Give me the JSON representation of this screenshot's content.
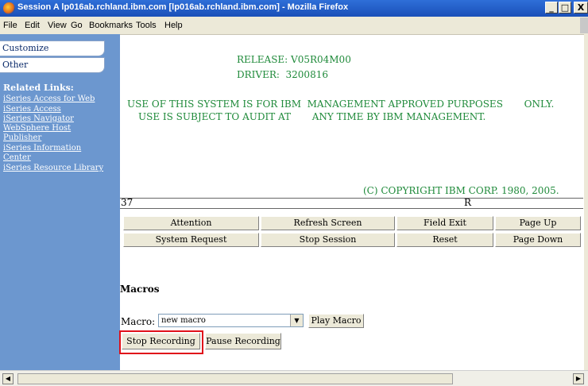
{
  "window": {
    "title": "Session A lp016ab.rchland.ibm.com [lp016ab.rchland.ibm.com] - Mozilla Firefox",
    "minimize": "_",
    "maximize": "□",
    "close": "X"
  },
  "menu": {
    "items": [
      {
        "label": "File"
      },
      {
        "label": "Edit"
      },
      {
        "label": "View"
      },
      {
        "label": "Go"
      },
      {
        "label": "Bookmarks"
      },
      {
        "label": "Tools"
      },
      {
        "label": "Help"
      }
    ]
  },
  "sidebar": {
    "tabs": [
      "Customize",
      "Other"
    ],
    "related_title": "Related Links:",
    "links": [
      "iSeries Access for Web",
      "iSeries Access",
      "iSeries Navigator",
      "WebSphere Host",
      "Publisher",
      "iSeries Information",
      "Center",
      "iSeries Resource Library"
    ]
  },
  "terminal": {
    "release": "RELEASE: V05R04M00",
    "driver": "DRIVER:  3200816",
    "notice_line1": "USE OF THIS SYSTEM IS FOR IBM  MANAGEMENT APPROVED PURPOSES       ONLY.",
    "notice_line2": "USE IS SUBJECT TO AUDIT AT       ANY TIME BY IBM MANAGEMENT.",
    "copyright": "(C) COPYRIGHT IBM CORP. 1980, 2005.",
    "status_left": "37",
    "status_right": "R"
  },
  "buttons": {
    "attention": "Attention",
    "refresh": "Refresh Screen",
    "field_exit": "Field Exit",
    "page_up": "Page Up",
    "system_request": "System Request",
    "stop_session": "Stop Session",
    "reset": "Reset",
    "page_down": "Page Down"
  },
  "macros": {
    "heading": "Macros",
    "label": "Macro:",
    "selected": "new macro",
    "play": "Play Macro",
    "stop_recording": "Stop Recording",
    "pause_recording": "Pause Recording"
  }
}
